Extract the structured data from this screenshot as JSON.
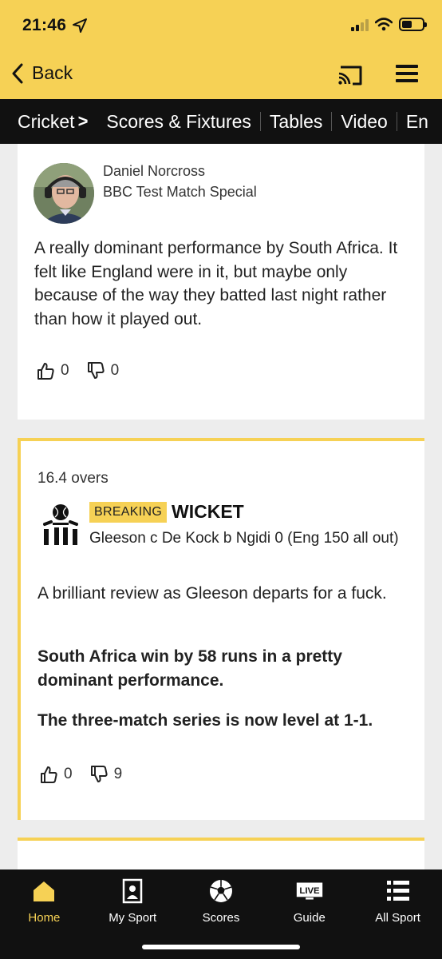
{
  "status": {
    "time": "21:46"
  },
  "header": {
    "back_label": "Back"
  },
  "nav": {
    "section": "Cricket",
    "items": [
      "Scores & Fixtures",
      "Tables",
      "Video",
      "En"
    ]
  },
  "post1": {
    "author_name": "Daniel Norcross",
    "author_role": "BBC Test Match Special",
    "body": "A really dominant performance by South Africa. It felt like England were in it, but maybe only because of the way they batted last night rather than how it played out.",
    "likes": "0",
    "dislikes": "0"
  },
  "post2": {
    "overs": "16.4 overs",
    "badge": "BREAKING",
    "title": "WICKET",
    "wicket_desc": "Gleeson c De Kock b Ngidi 0 (Eng 150 all out)",
    "p1": "A brilliant review as Gleeson departs for a fuck.",
    "p2": "South Africa win by 58 runs in a pretty dominant performance.",
    "p3": "The three-match series is now level at 1-1.",
    "likes": "0",
    "dislikes": "9"
  },
  "tabs": [
    {
      "label": "Home",
      "icon": "home-icon"
    },
    {
      "label": "My Sport",
      "icon": "my-sport-icon"
    },
    {
      "label": "Scores",
      "icon": "football-icon"
    },
    {
      "label": "Guide",
      "icon": "live-icon",
      "icon_text": "LIVE"
    },
    {
      "label": "All Sport",
      "icon": "list-icon"
    }
  ],
  "colors": {
    "accent": "#f6d155",
    "dark": "#111111",
    "background": "#ededed"
  }
}
